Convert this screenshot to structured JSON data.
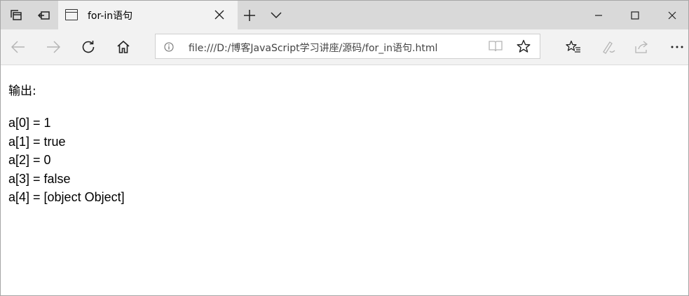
{
  "tab": {
    "title": "for-in语句"
  },
  "address": {
    "url": "file:///D:/博客JavaScript学习讲座/源码/for_in语句.html"
  },
  "content": {
    "heading": "输出:",
    "lines": [
      "a[0] = 1",
      "a[1] = true",
      "a[2] = 0",
      "a[3] = false",
      "a[4] = [object Object]"
    ]
  }
}
